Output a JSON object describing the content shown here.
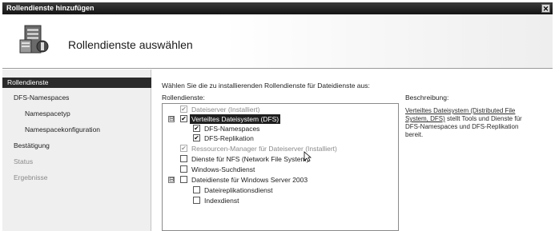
{
  "window": {
    "title": "Rollendienste hinzufügen",
    "close_glyph": "✕"
  },
  "header": {
    "title": "Rollendienste auswählen",
    "icon": "server-role-icon"
  },
  "sidebar": {
    "items": [
      {
        "label": "Rollendienste",
        "state": "active"
      },
      {
        "label": "DFS-Namespaces",
        "state": "normal"
      },
      {
        "label": "Namespacetyp",
        "state": "normal"
      },
      {
        "label": "Namespacekonfiguration",
        "state": "normal"
      },
      {
        "label": "Bestätigung",
        "state": "normal"
      },
      {
        "label": "Status",
        "state": "disabled"
      },
      {
        "label": "Ergebnisse",
        "state": "disabled"
      }
    ]
  },
  "main": {
    "instruction": "Wählen Sie die zu installierenden Rollendienste für Dateidienste aus:",
    "roles_label": "Rollendienste:",
    "description_label": "Beschreibung:",
    "description_link": "Verteiltes Dateisystem (Distributed File System, DFS)",
    "description_text": " stellt Tools und Dienste für DFS-Namespaces und DFS-Replikation bereit.",
    "tree": [
      {
        "label": "Dateiserver (Installiert)",
        "checked": true,
        "disabled": true
      },
      {
        "label": "Verteiltes Dateisystem (DFS)",
        "checked": true,
        "selected": true,
        "expander": "⊟"
      },
      {
        "label": "DFS-Namespaces",
        "checked": true
      },
      {
        "label": "DFS-Replikation",
        "checked": true
      },
      {
        "label": "Ressourcen-Manager für Dateiserver (Installiert)",
        "checked": true,
        "disabled": true
      },
      {
        "label": "Dienste für NFS (Network File System)",
        "checked": false
      },
      {
        "label": "Windows-Suchdienst",
        "checked": false
      },
      {
        "label": "Dateidienste für Windows Server 2003",
        "checked": false,
        "expander": "⊟"
      },
      {
        "label": "Dateireplikationsdienst",
        "checked": false
      },
      {
        "label": "Indexdienst",
        "checked": false
      }
    ]
  },
  "check_glyph": "✔"
}
